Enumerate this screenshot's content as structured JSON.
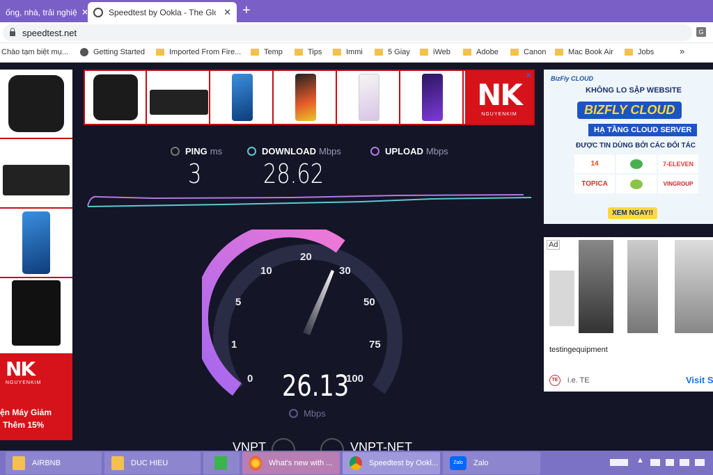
{
  "browser": {
    "tabs": [
      {
        "title": "ống, nhà, trải nghiệ",
        "active": false
      },
      {
        "title": "Speedtest by Ookla - The Global",
        "active": true
      }
    ],
    "new_tab_glyph": "+",
    "close_glyph": "✕",
    "url": "speedtest.net",
    "bookmarks": [
      {
        "label": "Chào tạm biệt mụ...",
        "icon": "none"
      },
      {
        "label": "Getting Started",
        "icon": "globe-icon"
      },
      {
        "label": "Imported From Fire...",
        "icon": "folder-icon"
      },
      {
        "label": "Temp",
        "icon": "folder-icon"
      },
      {
        "label": "Tips",
        "icon": "folder-icon"
      },
      {
        "label": "Immi",
        "icon": "folder-icon"
      },
      {
        "label": "5 Giay",
        "icon": "folder-icon"
      },
      {
        "label": "iWeb",
        "icon": "folder-icon"
      },
      {
        "label": "Adobe",
        "icon": "folder-icon"
      },
      {
        "label": "Canon",
        "icon": "folder-icon"
      },
      {
        "label": "Mac Book Air",
        "icon": "folder-icon"
      },
      {
        "label": "Jobs",
        "icon": "folder-icon"
      }
    ],
    "more_glyph": "»"
  },
  "speedtest": {
    "ping": {
      "label": "PING",
      "unit": "ms",
      "value": "3"
    },
    "download": {
      "label": "DOWNLOAD",
      "unit": "Mbps",
      "value": "28.62"
    },
    "upload": {
      "label": "UPLOAD",
      "unit": "Mbps",
      "value": ""
    },
    "gauge": {
      "labels": [
        "0",
        "1",
        "5",
        "10",
        "20",
        "30",
        "50",
        "75",
        "100"
      ],
      "current": "26.13",
      "unit": "Mbps"
    },
    "server": {
      "isp": "VNPT",
      "host": "VNPT-NET"
    },
    "colors": {
      "accent_pink": "#f079d6",
      "accent_purple": "#a467f0",
      "download_line": "#5ec8d4",
      "upload_line": "#b27ae8"
    }
  },
  "ads": {
    "left": {
      "brand": "NK",
      "brand_sub": "NGUYENKIM",
      "promo_line1": "ện Máy Giảm",
      "promo_line2": "Thêm 15%"
    },
    "top": {
      "brand": "NK",
      "brand_sub": "NGUYENKIM"
    },
    "right1": {
      "logo": "BizFly CLOUD",
      "line1": "KHÔNG LO SẬP WEBSITE",
      "headline": "BIZFLY CLOUD",
      "sub": "HẠ TẦNG CLOUD SERVER",
      "trust": "ĐƯỢC TIN DÙNG BỞI CÁC ĐỐI TÁC",
      "partners": [
        "14",
        "",
        "7-ELEVEN",
        "TOPICA",
        "",
        "VINGROUP"
      ],
      "cta": "XEM NGAY!!"
    },
    "right2": {
      "badge": "Ad",
      "advertiser": "testingequipment",
      "source": "i.e. TE",
      "cta": "Visit Si",
      "te_logo": "TE"
    }
  },
  "taskbar": {
    "items": [
      {
        "label": "AIRBNB",
        "icon": "folder-icon"
      },
      {
        "label": "DUC HIEU",
        "icon": "folder-icon"
      },
      {
        "label": "",
        "icon": "store-icon"
      },
      {
        "label": "What's new with ...",
        "icon": "firefox-icon"
      },
      {
        "label": "Speedtest by Ookl...",
        "icon": "chrome-icon"
      },
      {
        "label": "Zalo",
        "icon": "zalo-icon"
      }
    ],
    "zalo_logo": "Zalo"
  }
}
